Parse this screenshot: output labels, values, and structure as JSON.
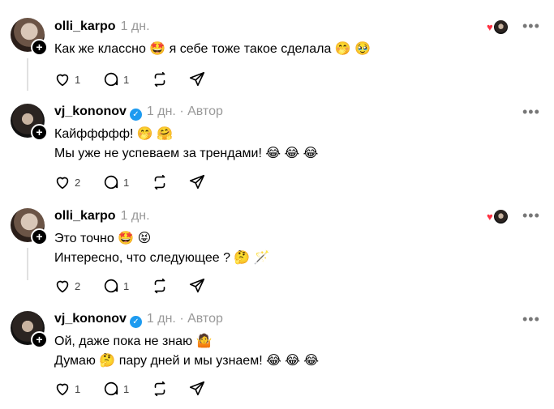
{
  "posts": [
    {
      "username": "olli_karpo",
      "time": "1 дн.",
      "author": "",
      "verified": false,
      "lines": [
        "Как же классно 🤩 я себе тоже такое сделала 🤭 🥹"
      ],
      "likes": "1",
      "replies": "1",
      "reacted": true
    },
    {
      "username": "vj_kononov",
      "time": "1 дн.",
      "author": "· Автор",
      "verified": true,
      "lines": [
        "Кайффффф! 🤭 🤗",
        "Мы уже не успеваем за трендами! 😂 😂 😂"
      ],
      "likes": "2",
      "replies": "1",
      "reacted": false
    },
    {
      "username": "olli_karpo",
      "time": "1 дн.",
      "author": "",
      "verified": false,
      "lines": [
        "Это точно 🤩 😝",
        "Интересно, что следующее ? 🤔 🪄"
      ],
      "likes": "2",
      "replies": "1",
      "reacted": true
    },
    {
      "username": "vj_kononov",
      "time": "1 дн.",
      "author": "· Автор",
      "verified": true,
      "lines": [
        "Ой, даже пока не знаю 🤷",
        "Думаю 🤔 пару дней и мы узнаем! 😂 😂 😂"
      ],
      "likes": "1",
      "replies": "1",
      "reacted": false
    }
  ],
  "icons": {
    "like": "heart-icon",
    "reply": "comment-icon",
    "repost": "repost-icon",
    "share": "send-icon",
    "more": "more-icon",
    "follow": "plus-icon",
    "verified": "verified-badge-icon"
  },
  "colors": {
    "reaction_heart": "#ff3040",
    "verified": "#1d9bf0",
    "muted": "#999999"
  }
}
